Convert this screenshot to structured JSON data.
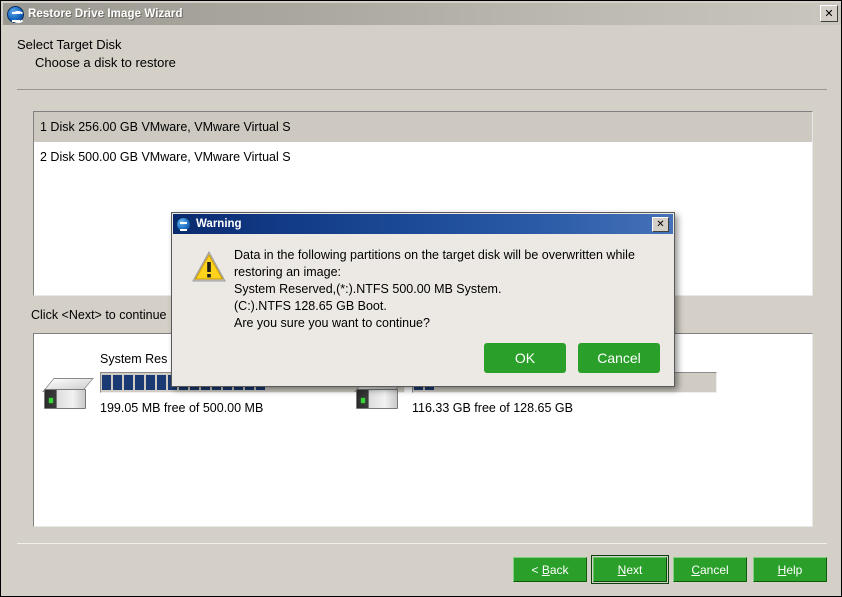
{
  "window": {
    "title": "Restore Drive Image Wizard",
    "icon": "restore-wizard-icon",
    "close_label": "✕"
  },
  "header": {
    "title": "Select Target Disk",
    "subtitle": "Choose a disk to restore"
  },
  "disk_list": {
    "rows": [
      {
        "label": "1 Disk 256.00 GB VMware,  VMware Virtual S",
        "selected": true
      },
      {
        "label": "2 Disk 500.00 GB VMware,  VMware Virtual S",
        "selected": false
      }
    ]
  },
  "instruction": "Click <Next> to continue",
  "partitions": [
    {
      "name": "System Res",
      "free_text": "199.05 MB free of 500.00 MB",
      "filled_blocks": 15,
      "total_blocks": 30,
      "icon": "hard-drive-icon"
    },
    {
      "name": "",
      "free_text": "116.33 GB free of 128.65 GB",
      "filled_blocks": 2,
      "total_blocks": 30,
      "icon": "hard-drive-icon"
    }
  ],
  "footer_buttons": [
    {
      "name": "back",
      "pre": "< ",
      "accel": "B",
      "post": "ack",
      "focused": false
    },
    {
      "name": "next",
      "pre": "",
      "accel": "N",
      "post": "ext",
      "focused": true
    },
    {
      "name": "cancel",
      "pre": "",
      "accel": "C",
      "post": "ancel",
      "focused": false
    },
    {
      "name": "help",
      "pre": "",
      "accel": "H",
      "post": "elp",
      "focused": false
    }
  ],
  "dialog": {
    "title": "Warning",
    "icon": "warning-triangle-icon",
    "close_label": "✕",
    "message_lines": [
      "Data in the following partitions on the target disk will be overwritten while",
      "restoring an image:",
      "System Reserved,(*:).NTFS 500.00 MB System.",
      "(C:).NTFS 128.65 GB Boot.",
      "Are you sure you want to continue?"
    ],
    "ok_label": "OK",
    "cancel_label": "Cancel"
  },
  "colors": {
    "window_bg": "#d4d0c8",
    "button_green": "#2aa02a",
    "dialog_title_blue": "#123a86",
    "partition_block": "#1b3a73",
    "warning_yellow": "#f2c200"
  }
}
